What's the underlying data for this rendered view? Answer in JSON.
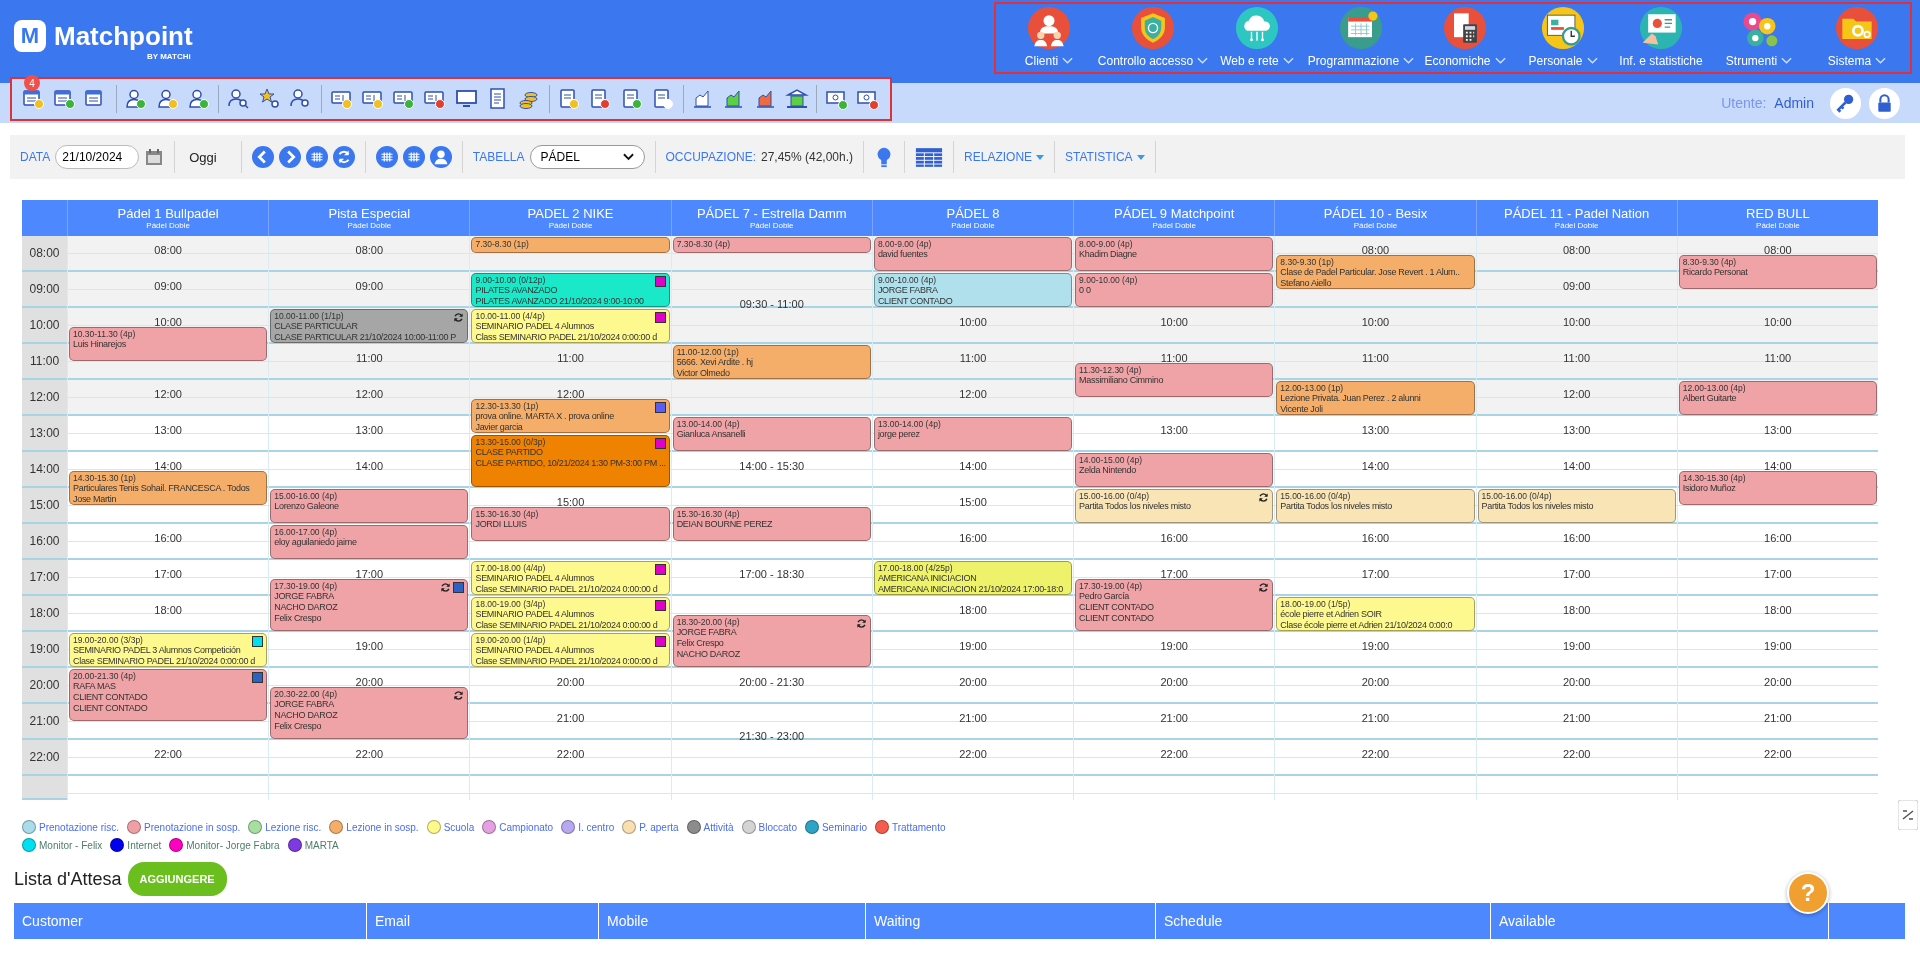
{
  "header": {
    "logo_letter": "M",
    "brand": "Matchpoint",
    "tagline": "BY MATCHi"
  },
  "menu": [
    {
      "label": "Clienti",
      "dropdown": true
    },
    {
      "label": "Controllo accesso",
      "dropdown": true
    },
    {
      "label": "Web e rete",
      "dropdown": true
    },
    {
      "label": "Programmazione",
      "dropdown": true
    },
    {
      "label": "Economiche",
      "dropdown": true
    },
    {
      "label": "Personale",
      "dropdown": true
    },
    {
      "label": "Inf. e statistiche",
      "dropdown": false
    },
    {
      "label": "Strumenti",
      "dropdown": true
    },
    {
      "label": "Sistema",
      "dropdown": true
    }
  ],
  "toolbar": {
    "badge": "4"
  },
  "user": {
    "label": "Utente:",
    "name": "Admin"
  },
  "filters": {
    "date_label": "DATA",
    "date": "21/10/2024",
    "today": "Oggi",
    "table_label": "TABELLA",
    "table_value": "PÁDEL",
    "occupancy_label": "OCCUPAZIONE:",
    "occupancy": "27,45% (42,00h.)",
    "menus": [
      "RELAZIONE",
      "STATISTICA"
    ]
  },
  "calendar": {
    "hours": [
      "08:00",
      "09:00",
      "10:00",
      "11:00",
      "12:00",
      "13:00",
      "14:00",
      "15:00",
      "16:00",
      "17:00",
      "18:00",
      "19:00",
      "20:00",
      "21:00",
      "22:00"
    ],
    "courts": [
      {
        "name": "Pádel 1 Bullpadel",
        "subtitle": "Pádel Doble",
        "slots": [
          "08:00",
          "09:00",
          "10:00",
          "12:00",
          "13:00",
          "14:00",
          "16:00",
          "17:00",
          "18:00",
          "22:00"
        ],
        "events": [
          {
            "color": "#efa3a6",
            "sync": false,
            "lines": [
              "10.30-11.30 (4p)",
              "Luis Hinarejos"
            ]
          },
          {
            "color": "#f4ae6a",
            "sync": false,
            "lines": [
              "14.30-15.30 (1p)",
              "Particulares Tenis Sohail. FRANCESCA . Todos",
              "Jose Martin"
            ]
          },
          {
            "color": "#fef98e",
            "sync": false,
            "marker": {
              "color": "#00e1ee"
            },
            "lines": [
              "19.00-20.00 (3/3p)",
              "SEMINARIO PADEL 3 Alumnos Competición",
              "Clase SEMINARIO PADEL  21/10/2024 0:00:00 d"
            ]
          },
          {
            "color": "#efa3a6",
            "sync": false,
            "marker": {
              "color": "#2d62c4"
            },
            "lines": [
              "20.00-21.30 (4p)",
              "RAFA MAS",
              "CLIENT CONTADO",
              "CLIENT CONTADO"
            ]
          }
        ]
      },
      {
        "name": "Pista Especial",
        "subtitle": "Pádel Doble",
        "slots": [
          "08:00",
          "09:00",
          "11:00",
          "12:00",
          "13:00",
          "14:00",
          "17:00",
          "19:00",
          "20:00",
          "22:00"
        ],
        "events": [
          {
            "color": "#a6a6a6",
            "sync": true,
            "lines": [
              "10.00-11.00 (1/1p)",
              "CLASE PARTICULAR",
              "CLASE PARTICULAR  21/10/2024 10:00-11:00 P"
            ]
          },
          {
            "color": "#efa3a6",
            "sync": false,
            "lines": [
              "15.00-16.00 (4p)",
              "Lorenzo Galeone"
            ]
          },
          {
            "color": "#efa3a6",
            "sync": false,
            "lines": [
              "16.00-17.00 (4p)",
              "eloy aguilaniedo jaime"
            ]
          },
          {
            "color": "#efa3a6",
            "sync": true,
            "marker": {
              "color": "#2d62c4"
            },
            "lines": [
              "17.30-19.00 (4p)",
              "JORGE FABRA",
              "NACHO DAROZ",
              "Felix Crespo"
            ]
          },
          {
            "color": "#efa3a6",
            "sync": true,
            "lines": [
              "20.30-22.00 (4p)",
              "JORGE FABRA",
              "NACHO DAROZ",
              "Felix Crespo"
            ]
          }
        ]
      },
      {
        "name": "PADEL 2 NIKE",
        "subtitle": "Pádel Doble",
        "slots": [
          "11:00",
          "12:00",
          "15:00",
          "20:00",
          "21:00",
          "22:00"
        ],
        "events": [
          {
            "color": "#f4ae6a",
            "sync": false,
            "lines": [
              "7.30-8.30 (1p)"
            ]
          },
          {
            "color": "#1ae9c9",
            "sync": false,
            "marker": {
              "color": "#e000c8"
            },
            "lines": [
              "9.00-10.00 (0/12p)",
              "PILATES AVANZADO",
              "PILATES AVANZADO  21/10/2024 9:00-10:00"
            ]
          },
          {
            "color": "#fef98e",
            "sync": false,
            "marker": {
              "color": "#e000c8"
            },
            "lines": [
              "10.00-11.00 (4/4p)",
              "SEMINARIO PADEL 4 Alumnos",
              "Class SEMINARIO PADEL  21/10/2024 0:00:00 d"
            ]
          },
          {
            "color": "#f4ae6a",
            "sync": false,
            "marker": {
              "color": "#5a5ef0"
            },
            "lines": [
              "12.30-13.30 (1p)",
              "prova online. MARTA X . prova online",
              "Javier garcia"
            ]
          },
          {
            "color": "#ef8200",
            "sync": false,
            "marker": {
              "color": "#e000c8"
            },
            "lines": [
              "13.30-15.00 (0/3p)",
              "CLASE PARTIDO",
              "CLASE PARTIDO, 10/21/2024 1:30 PM-3:00 PM ..."
            ]
          },
          {
            "color": "#efa3a6",
            "sync": false,
            "lines": [
              "15.30-16.30 (4p)",
              "JORDI LLUIS"
            ]
          },
          {
            "color": "#fef98e",
            "sync": false,
            "marker": {
              "color": "#e000c8"
            },
            "lines": [
              "17.00-18.00 (4/4p)",
              "SEMINARIO PADEL 4 Alumnos",
              "Clase SEMINARIO PADEL  21/10/2024 0:00:00 d"
            ]
          },
          {
            "color": "#fef98e",
            "sync": false,
            "marker": {
              "color": "#e000c8"
            },
            "lines": [
              "18.00-19.00 (3/4p)",
              "SEMINARIO PADEL 4 Alumnos",
              "Clase SEMINARIO PADEL  21/10/2024 0:00:00 d"
            ]
          },
          {
            "color": "#fef98e",
            "sync": false,
            "marker": {
              "color": "#e000c8"
            },
            "lines": [
              "19.00-20.00 (1/4p)",
              "SEMINARIO PADEL 4 Alumnos",
              "Clase SEMINARIO PADEL  21/10/2024 0:00:00 d"
            ]
          }
        ]
      },
      {
        "name": "PÁDEL 7 - Estrella Damm",
        "subtitle": "Pádel Doble",
        "slots": [
          "09:30 - 11:00",
          "14:00 - 15:30",
          "17:00 - 18:30",
          "20:00 - 21:30",
          "21:30 - 23:00"
        ],
        "events": [
          {
            "color": "#efa3a6",
            "sync": false,
            "lines": [
              "7.30-8.30 (4p)"
            ]
          },
          {
            "color": "#f4ae6a",
            "sync": false,
            "lines": [
              "11.00-12.00 (1p)",
              "5666. Xevi Ardite . hj",
              "Victor Olmedo"
            ]
          },
          {
            "color": "#efa3a6",
            "sync": false,
            "lines": [
              "13.00-14.00 (4p)",
              "Gianluca Ansanelli"
            ]
          },
          {
            "color": "#efa3a6",
            "sync": false,
            "lines": [
              "15.30-16.30 (4p)",
              "DEIAN BOURNE PEREZ"
            ]
          },
          {
            "color": "#efa3a6",
            "sync": true,
            "lines": [
              "18.30-20.00 (4p)",
              "JORGE FABRA",
              "Felix Crespo",
              "NACHO DAROZ"
            ]
          }
        ]
      },
      {
        "name": "PÁDEL 8",
        "subtitle": "Pádel Doble",
        "slots": [
          "10:00",
          "11:00",
          "12:00",
          "14:00",
          "15:00",
          "16:00",
          "18:00",
          "19:00",
          "20:00",
          "21:00",
          "22:00"
        ],
        "events": [
          {
            "color": "#efa3a6",
            "sync": false,
            "lines": [
              "8.00-9.00 (4p)",
              "david fuentes"
            ]
          },
          {
            "color": "#b0e0ec",
            "sync": false,
            "lines": [
              "9.00-10.00 (4p)",
              "JORGE FABRA",
              "CLIENT CONTADO"
            ]
          },
          {
            "color": "#efa3a6",
            "sync": false,
            "lines": [
              "13.00-14.00 (4p)",
              "jorge perez"
            ]
          },
          {
            "color": "#eef26a",
            "sync": false,
            "lines": [
              "17.00-18.00 (4/25p)",
              "AMERICANA INICIACION",
              "AMERICANA INICIACION  21/10/2024 17:00-18:0"
            ]
          }
        ]
      },
      {
        "name": "PÁDEL 9 Matchpoint",
        "subtitle": "Pádel Doble",
        "slots": [
          "10:00",
          "11:00",
          "13:00",
          "16:00",
          "17:00",
          "19:00",
          "20:00",
          "21:00",
          "22:00"
        ],
        "events": [
          {
            "color": "#efa3a6",
            "sync": false,
            "lines": [
              "8.00-9.00 (4p)",
              "Khadim Diagne"
            ]
          },
          {
            "color": "#efa3a6",
            "sync": false,
            "lines": [
              "9.00-10.00 (4p)",
              "0 0"
            ]
          },
          {
            "color": "#efa3a6",
            "sync": false,
            "lines": [
              "11.30-12.30 (4p)",
              "Massimiliano Cimmino"
            ]
          },
          {
            "color": "#efa3a6",
            "sync": false,
            "lines": [
              "14.00-15.00 (4p)",
              "Zelda Nintendo"
            ]
          },
          {
            "color": "#f9e4b5",
            "sync": true,
            "lines": [
              "15.00-16.00 (0/4p)",
              "Partita Todos los niveles misto"
            ]
          },
          {
            "color": "#efa3a6",
            "sync": true,
            "lines": [
              "17.30-19.00 (4p)",
              "Pedro García",
              "CLIENT CONTADO",
              "CLIENT CONTADO"
            ]
          }
        ]
      },
      {
        "name": "PÁDEL 10 - Besix",
        "subtitle": "Pádel Doble",
        "slots": [
          "08:00",
          "10:00",
          "11:00",
          "13:00",
          "14:00",
          "16:00",
          "17:00",
          "19:00",
          "20:00",
          "21:00",
          "22:00"
        ],
        "events": [
          {
            "color": "#f4ae6a",
            "sync": false,
            "lines": [
              "8.30-9.30 (1p)",
              "Clase de Padel Particular. Jose Revert . 1 Alum..",
              "Stefano Aiello"
            ]
          },
          {
            "color": "#f4ae6a",
            "sync": false,
            "lines": [
              "12.00-13.00 (1p)",
              "Lezione Privata. Juan Perez . 2 alunni",
              "Vicente Joli"
            ]
          },
          {
            "color": "#f9e4b5",
            "sync": false,
            "lines": [
              "15.00-16.00 (0/4p)",
              "Partita Todos los niveles misto"
            ]
          },
          {
            "color": "#fef98e",
            "sync": false,
            "lines": [
              "18.00-19.00 (1/5p)",
              "école pierre et Adrien SOIR",
              "Clase école pierre et Adrien 21/10/2024 0:00:0"
            ]
          }
        ]
      },
      {
        "name": "PÁDEL 11 - Padel Nation",
        "subtitle": "Pádel Doble",
        "slots": [
          "08:00",
          "09:00",
          "10:00",
          "11:00",
          "12:00",
          "13:00",
          "14:00",
          "16:00",
          "17:00",
          "18:00",
          "19:00",
          "20:00",
          "21:00",
          "22:00"
        ],
        "events": [
          {
            "color": "#f9e4b5",
            "sync": false,
            "lines": [
              "15.00-16.00 (0/4p)",
              "Partita Todos los niveles misto"
            ]
          }
        ]
      },
      {
        "name": "RED BULL",
        "subtitle": "Pádel Doble",
        "slots": [
          "08:00",
          "10:00",
          "11:00",
          "13:00",
          "14:00",
          "16:00",
          "17:00",
          "18:00",
          "19:00",
          "20:00",
          "21:00",
          "22:00"
        ],
        "events": [
          {
            "color": "#efa3a6",
            "sync": false,
            "lines": [
              "8.30-9.30 (4p)",
              "Ricardo Personat"
            ]
          },
          {
            "color": "#efa3a6",
            "sync": false,
            "lines": [
              "12.00-13.00 (4p)",
              "Albert Guitarte"
            ]
          },
          {
            "color": "#efa3a6",
            "sync": false,
            "lines": [
              "14.30-15.30 (4p)",
              "Isidoro Muñoz"
            ]
          }
        ]
      }
    ]
  },
  "legend": [
    [
      {
        "label": "Prenotazione risc.",
        "color": "#a8dcea"
      },
      {
        "label": "Prenotazione in sosp.",
        "color": "#f0a0a4"
      },
      {
        "label": "Lezione risc.",
        "color": "#a6dfa0"
      },
      {
        "label": "Lezione in sosp.",
        "color": "#f4ae6a"
      },
      {
        "label": "Scuola",
        "color": "#fdf98a"
      },
      {
        "label": "Campionato",
        "color": "#e4a0e0"
      },
      {
        "label": "I. centro",
        "color": "#b7a8ef"
      },
      {
        "label": "P. aperta",
        "color": "#f9deb0"
      },
      {
        "label": "Attività",
        "color": "#8c8c8c"
      },
      {
        "label": "Bloccato",
        "color": "#d4d4d4"
      },
      {
        "label": "Seminario",
        "color": "#2fa3c6"
      },
      {
        "label": "Trattamento",
        "color": "#f55c4d"
      }
    ],
    [
      {
        "label": "Monitor - Felix",
        "color": "#00e0f0"
      },
      {
        "label": "Internet",
        "color": "#0000ee"
      },
      {
        "label": "Monitor- Jorge Fabra",
        "color": "#ff00c0"
      },
      {
        "label": "MARTA",
        "color": "#7c3ae0"
      }
    ]
  ],
  "waitlist": {
    "title": "Lista d'Attesa",
    "add_button": "AGGIUNGERE",
    "columns": [
      "Customer",
      "Email",
      "Mobile",
      "Waiting",
      "Schedule",
      "Available"
    ]
  },
  "help": "?"
}
